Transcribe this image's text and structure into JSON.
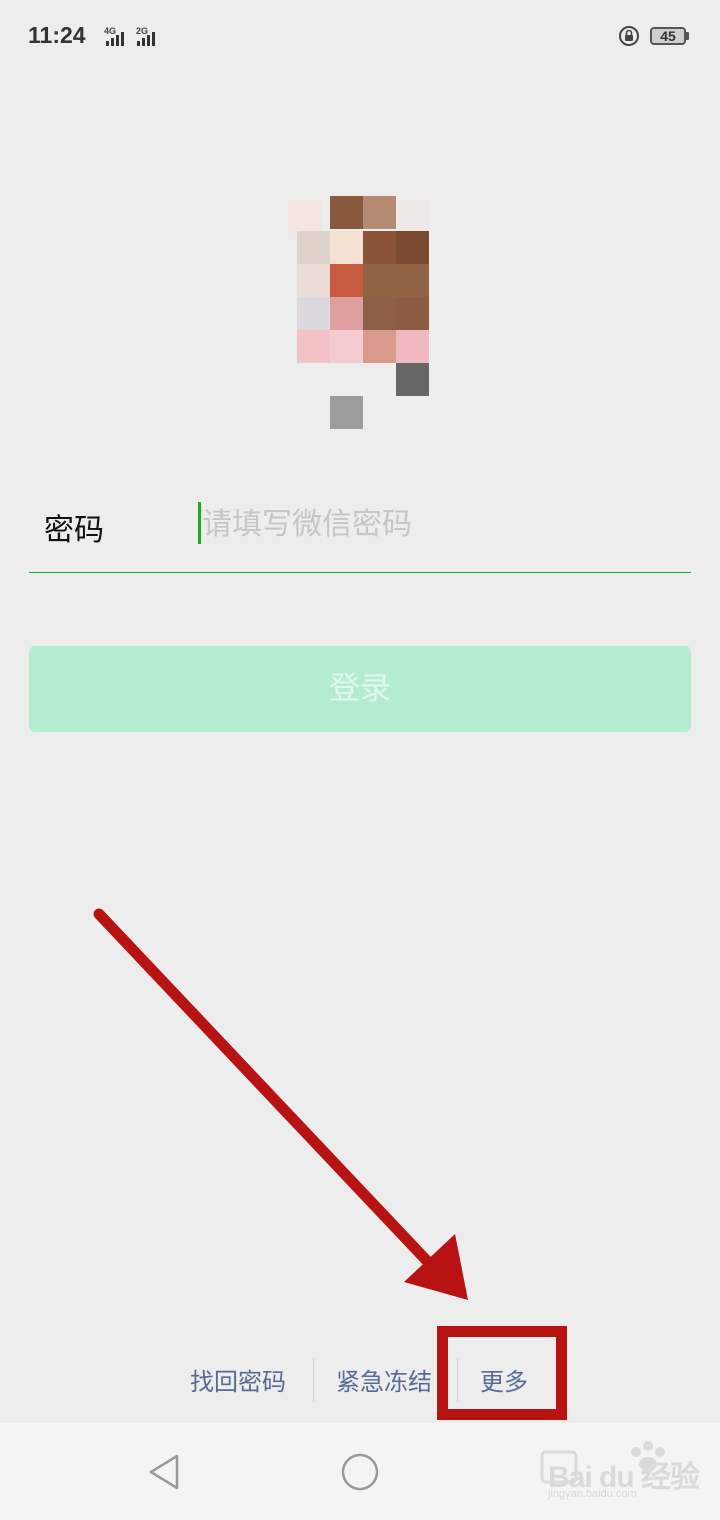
{
  "status_bar": {
    "time": "11:24",
    "network_1": "4G",
    "network_2": "2G",
    "battery_level": "45"
  },
  "login": {
    "password_label": "密码",
    "password_placeholder": "请填写微信密码",
    "password_value": "",
    "login_button": "登录"
  },
  "footer_links": {
    "recover_password": "找回密码",
    "emergency_freeze": "紧急冻结",
    "more": "更多"
  },
  "nav_bar": {
    "back": "back-icon",
    "home": "home-icon"
  },
  "watermark": {
    "brand": "Bai du 经验",
    "url": "jingyan.baidu.com"
  },
  "colors": {
    "accent": "#1aad19",
    "button_disabled": "#b3ecce",
    "link": "#576b95",
    "annotation": "#b71313"
  }
}
